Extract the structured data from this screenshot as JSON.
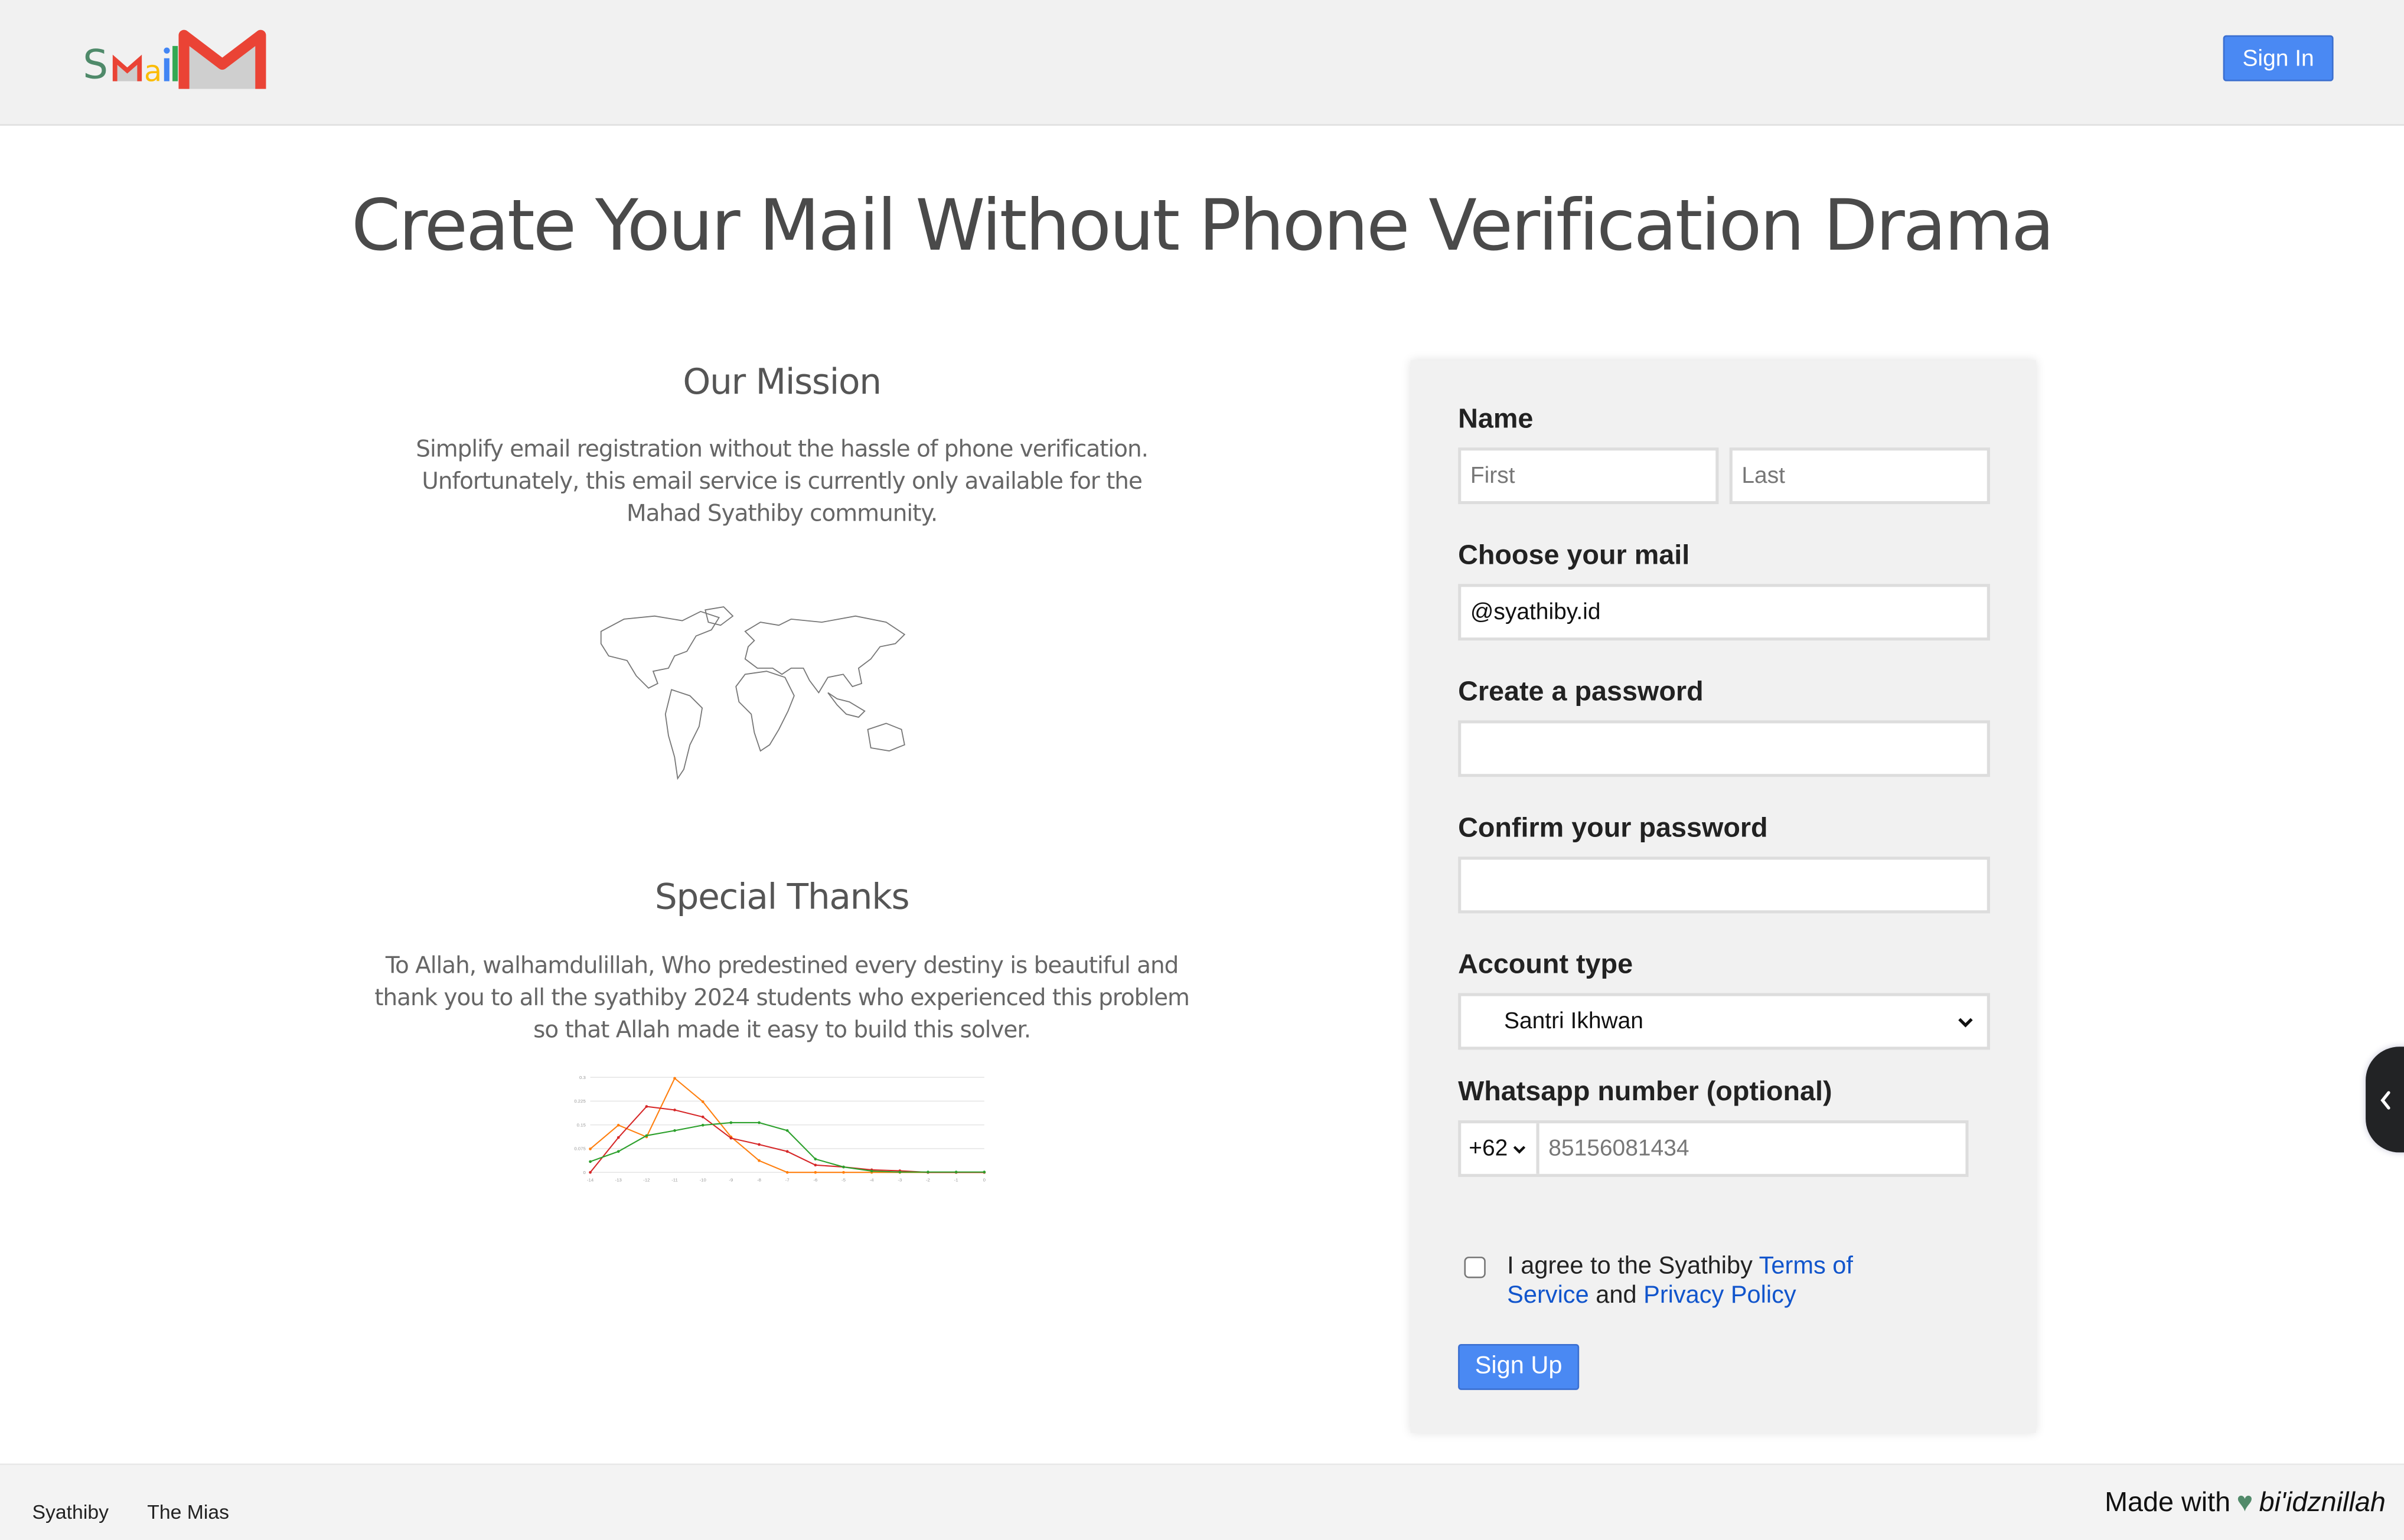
{
  "header": {
    "logo_text": "SmailM",
    "sign_in_label": "Sign In",
    "button_color": "#4a89f3"
  },
  "title": "Create Your Mail Without Phone Verification Drama",
  "mission": {
    "heading": "Our Mission",
    "text": "Simplify email registration without the hassle of phone verification. Unfortunately, this email service is currently only available for the Mahad Syathiby community.",
    "image_icon": "world-map"
  },
  "thanks": {
    "heading": "Special Thanks",
    "text": "To Allah, walhamdulillah, Who predestined every destiny is beautiful and thank you to all the syathiby 2024 students who experienced this problem so that Allah made it easy to build this solver."
  },
  "chart_data": {
    "type": "line",
    "x": [
      -14,
      -13,
      -12,
      -11,
      -10,
      -9,
      -8,
      -7,
      -6,
      -5,
      -4,
      -3,
      -2,
      -1,
      0
    ],
    "xticks": [
      "-14",
      "-13",
      "-12",
      "-11",
      "-10",
      "-9",
      "-8",
      "-7",
      "-6",
      "-5",
      "-4",
      "-3",
      "-2",
      "-1",
      "0"
    ],
    "yticks": [
      "0",
      "0.075",
      "0.15",
      "0.225",
      "0.3"
    ],
    "ylim": [
      0,
      0.3
    ],
    "grid": true,
    "series": [
      {
        "color": "#ff7f0e",
        "values": [
          0.074,
          0.149,
          0.112,
          0.297,
          0.223,
          0.112,
          0.037,
          0,
          0,
          0,
          0,
          0,
          0,
          0,
          0
        ]
      },
      {
        "color": "#d62728",
        "values": [
          0,
          0.11,
          0.208,
          0.197,
          0.175,
          0.108,
          0.088,
          0.066,
          0.023,
          0.017,
          0.008,
          0.005,
          0,
          0,
          0
        ]
      },
      {
        "color": "#2ca02c",
        "values": [
          0.034,
          0.066,
          0.116,
          0.132,
          0.149,
          0.157,
          0.157,
          0.132,
          0.042,
          0.017,
          0.004,
          0.001,
          0.001,
          0.001,
          0.001
        ]
      }
    ]
  },
  "form": {
    "name_label": "Name",
    "first_placeholder": "First",
    "last_placeholder": "Last",
    "mail_label": "Choose your mail",
    "mail_value": "@syathiby.id",
    "password_label": "Create a password",
    "confirm_label": "Confirm your password",
    "account_label": "Account type",
    "account_value": "Santri Ikhwan",
    "whatsapp_label": "Whatsapp number (optional)",
    "country_code": "+62",
    "whatsapp_placeholder": "85156081434",
    "agree_prefix": "I agree to the Syathiby ",
    "terms_link": "Terms of Service",
    "agree_and": " and ",
    "privacy_link": "Privacy Policy",
    "agree_checked": false,
    "sign_up_label": "Sign Up"
  },
  "footer": {
    "links": [
      "Syathiby",
      "The Mias"
    ],
    "made_with": "Made with",
    "heart_color": "#528a6a",
    "signature": "bi'idznillah"
  },
  "side_tab": {
    "icon": "chevron-left"
  }
}
